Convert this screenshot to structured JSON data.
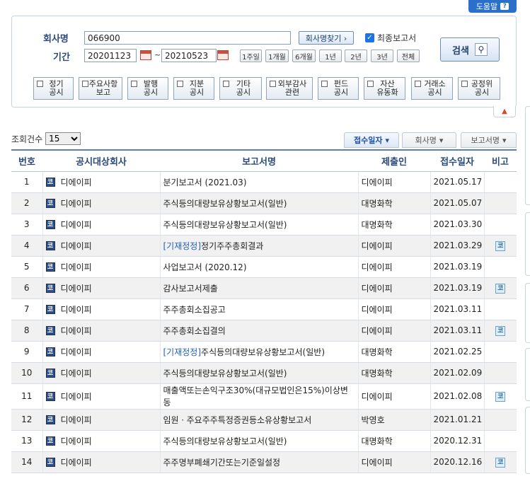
{
  "help": {
    "label": "도움말"
  },
  "search": {
    "company_label": "회사명",
    "company_value": "066900",
    "find_company_label": "회사명찾기 ›",
    "final_report_label": "최종보고서",
    "period_label": "기간",
    "date_from": "20201123",
    "date_to": "20210523",
    "period_buttons": [
      "1주일",
      "1개월",
      "6개월",
      "1년",
      "2년",
      "3년",
      "전체"
    ],
    "search_label": "검색"
  },
  "categories": [
    {
      "l1": "정기",
      "l2": "공시"
    },
    {
      "l1": "주요사항",
      "l2": "보고"
    },
    {
      "l1": "발행",
      "l2": "공시"
    },
    {
      "l1": "지분",
      "l2": "공시"
    },
    {
      "l1": "기타",
      "l2": "공시"
    },
    {
      "l1": "외부감사",
      "l2": "관련"
    },
    {
      "l1": "펀드",
      "l2": "공시"
    },
    {
      "l1": "자산",
      "l2": "유동화"
    },
    {
      "l1": "거래소",
      "l2": "공시"
    },
    {
      "l1": "공정위",
      "l2": "공시"
    }
  ],
  "list": {
    "count_label": "조회건수",
    "count_value": "15",
    "sort_buttons": [
      "접수일자",
      "회사명",
      "보고서명"
    ],
    "headers": [
      "번호",
      "공시대상회사",
      "보고서명",
      "제출인",
      "접수일자",
      "비고"
    ],
    "rows": [
      {
        "no": "1",
        "company": "디에이피",
        "prefix": "",
        "report": "분기보고서 (2021.03)",
        "submitter": "디에이피",
        "date": "2021.05.17",
        "note": false
      },
      {
        "no": "2",
        "company": "디에이피",
        "prefix": "",
        "report": "주식등의대량보유상황보고서(일반)",
        "submitter": "대명화학",
        "date": "2021.05.07",
        "note": false
      },
      {
        "no": "3",
        "company": "디에이피",
        "prefix": "",
        "report": "주식등의대량보유상황보고서(일반)",
        "submitter": "대명화학",
        "date": "2021.03.30",
        "note": false
      },
      {
        "no": "4",
        "company": "디에이피",
        "prefix": "[기재정정]",
        "report": "정기주주총회결과",
        "submitter": "디에이피",
        "date": "2021.03.29",
        "note": true
      },
      {
        "no": "5",
        "company": "디에이피",
        "prefix": "",
        "report": "사업보고서 (2020.12)",
        "submitter": "디에이피",
        "date": "2021.03.19",
        "note": false
      },
      {
        "no": "6",
        "company": "디에이피",
        "prefix": "",
        "report": "감사보고서제출",
        "submitter": "디에이피",
        "date": "2021.03.19",
        "note": true
      },
      {
        "no": "7",
        "company": "디에이피",
        "prefix": "",
        "report": "주주총회소집공고",
        "submitter": "디에이피",
        "date": "2021.03.11",
        "note": false
      },
      {
        "no": "8",
        "company": "디에이피",
        "prefix": "",
        "report": "주주총회소집결의",
        "submitter": "디에이피",
        "date": "2021.03.11",
        "note": true
      },
      {
        "no": "9",
        "company": "디에이피",
        "prefix": "[기재정정]",
        "report": "주식등의대량보유상황보고서(일반)",
        "submitter": "대명화학",
        "date": "2021.02.25",
        "note": false
      },
      {
        "no": "10",
        "company": "디에이피",
        "prefix": "",
        "report": "주식등의대량보유상황보고서(일반)",
        "submitter": "대명화학",
        "date": "2021.02.09",
        "note": false
      },
      {
        "no": "11",
        "company": "디에이피",
        "prefix": "",
        "report": "매출액또는손익구조30%(대규모법인은15%)이상변동",
        "submitter": "디에이피",
        "date": "2021.02.08",
        "note": true
      },
      {
        "no": "12",
        "company": "디에이피",
        "prefix": "",
        "report": "임원ㆍ주요주주특정증권등소유상황보고서",
        "submitter": "박영호",
        "date": "2021.01.21",
        "note": false
      },
      {
        "no": "13",
        "company": "디에이피",
        "prefix": "",
        "report": "주식등의대량보유상황보고서(일반)",
        "submitter": "대명화학",
        "date": "2020.12.31",
        "note": false
      },
      {
        "no": "14",
        "company": "디에이피",
        "prefix": "",
        "report": "주주명부폐쇄기간또는기준일설정",
        "submitter": "디에이피",
        "date": "2020.12.16",
        "note": true
      }
    ]
  }
}
